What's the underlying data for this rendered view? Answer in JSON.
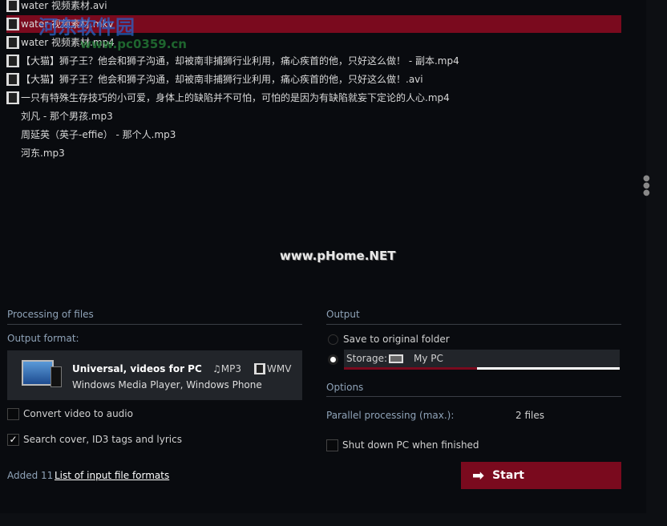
{
  "files": [
    {
      "name": "water 视频素材.avi",
      "type": "video",
      "selected": false
    },
    {
      "name": "water 视频素材.mkv",
      "type": "video",
      "selected": true
    },
    {
      "name": "water 视频素材.mp4",
      "type": "video",
      "selected": false
    },
    {
      "name": "【大猫】狮子王？他会和狮子沟通，却被南非捕狮行业利用，痛心疾首的他，只好这么做！ - 副本.mp4",
      "type": "video",
      "selected": false
    },
    {
      "name": "【大猫】狮子王？他会和狮子沟通，却被南非捕狮行业利用，痛心疾首的他，只好这么做！.avi",
      "type": "video",
      "selected": false
    },
    {
      "name": "一只有特殊生存技巧的小可爱，身体上的缺陷并不可怕，可怕的是因为有缺陷就妄下定论的人心.mp4",
      "type": "video",
      "selected": false
    },
    {
      "name": "刘凡 - 那个男孩.mp3",
      "type": "audio",
      "selected": false
    },
    {
      "name": "周延英（英子-effie） - 那个人.mp3",
      "type": "audio",
      "selected": false
    },
    {
      "name": "河东.mp3",
      "type": "audio",
      "selected": false
    }
  ],
  "watermarks": {
    "top": "河东软件园",
    "url": "www.pc0359.cn",
    "center": "www.pHome.NET"
  },
  "processing": {
    "title": "Processing of files",
    "output_format_label": "Output format:",
    "format_title": "Universal, videos for PC",
    "format_sub": "Windows Media Player, Windows Phone",
    "audio_fmt": "MP3",
    "video_fmt": "WMV",
    "convert_audio": "Convert video to audio",
    "convert_audio_checked": false,
    "search_cover": "Search cover, ID3 tags and lyrics",
    "search_cover_checked": true,
    "added": "Added 11",
    "formats_link": "List of input file formats"
  },
  "output": {
    "title": "Output",
    "save_original": "Save to original folder",
    "storage_label": "Storage:",
    "storage_value": "My PC",
    "selected": "storage"
  },
  "options": {
    "title": "Options",
    "parallel_label": "Parallel processing (max.):",
    "parallel_value": "2 files",
    "shutdown": "Shut down PC when finished",
    "shutdown_checked": false
  },
  "start_label": "Start",
  "colors": {
    "accent": "#7a0a1e",
    "section": "#8fa3b8"
  }
}
